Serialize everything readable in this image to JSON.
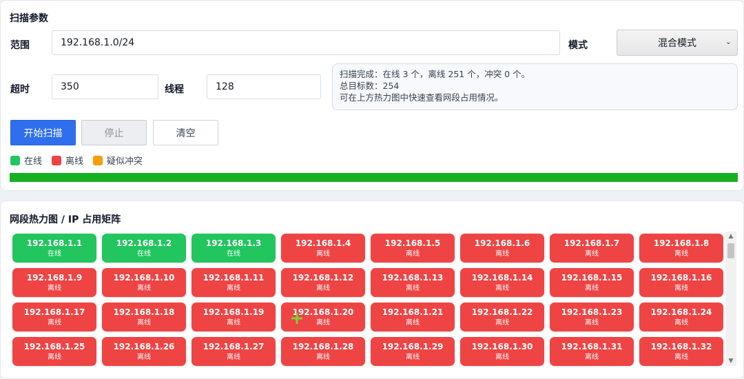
{
  "params": {
    "title": "扫描参数",
    "range_label": "范围",
    "range_value": "192.168.1.0/24",
    "mode_label": "模式",
    "mode_value": "混合模式",
    "timeout_label": "超时",
    "timeout_value": "350",
    "threads_label": "线程",
    "threads_value": "128",
    "info_lines": [
      "扫描完成：在线 3 个，离线 251 个，冲突 0 个。",
      "总目标数：254",
      "可在上方热力图中快速查看网段占用情况。"
    ],
    "buttons": {
      "start": "开始扫描",
      "stop": "停止",
      "clear": "清空"
    },
    "legend": [
      {
        "label": "在线",
        "color": "#22c55e"
      },
      {
        "label": "离线",
        "color": "#ef4444"
      },
      {
        "label": "疑似冲突",
        "color": "#f59e0b"
      }
    ],
    "progress_percent": 100
  },
  "heatmap": {
    "title": "网段热力图 / IP 占用矩阵",
    "colors": {
      "online": "#22c55e",
      "offline": "#ef4444",
      "conflict": "#f59e0b"
    },
    "cells": [
      {
        "ip": "192.168.1.1",
        "status": "在线"
      },
      {
        "ip": "192.168.1.2",
        "status": "在线"
      },
      {
        "ip": "192.168.1.3",
        "status": "在线"
      },
      {
        "ip": "192.168.1.4",
        "status": "离线"
      },
      {
        "ip": "192.168.1.5",
        "status": "离线"
      },
      {
        "ip": "192.168.1.6",
        "status": "离线"
      },
      {
        "ip": "192.168.1.7",
        "status": "离线"
      },
      {
        "ip": "192.168.1.8",
        "status": "离线"
      },
      {
        "ip": "192.168.1.9",
        "status": "离线"
      },
      {
        "ip": "192.168.1.10",
        "status": "离线"
      },
      {
        "ip": "192.168.1.11",
        "status": "离线"
      },
      {
        "ip": "192.168.1.12",
        "status": "离线"
      },
      {
        "ip": "192.168.1.13",
        "status": "离线"
      },
      {
        "ip": "192.168.1.14",
        "status": "离线"
      },
      {
        "ip": "192.168.1.15",
        "status": "离线"
      },
      {
        "ip": "192.168.1.16",
        "status": "离线"
      },
      {
        "ip": "192.168.1.17",
        "status": "离线"
      },
      {
        "ip": "192.168.1.18",
        "status": "离线"
      },
      {
        "ip": "192.168.1.19",
        "status": "离线"
      },
      {
        "ip": "192.168.1.20",
        "status": "离线"
      },
      {
        "ip": "192.168.1.21",
        "status": "离线"
      },
      {
        "ip": "192.168.1.22",
        "status": "离线"
      },
      {
        "ip": "192.168.1.23",
        "status": "离线"
      },
      {
        "ip": "192.168.1.24",
        "status": "离线"
      },
      {
        "ip": "192.168.1.25",
        "status": "离线"
      },
      {
        "ip": "192.168.1.26",
        "status": "离线"
      },
      {
        "ip": "192.168.1.27",
        "status": "离线"
      },
      {
        "ip": "192.168.1.28",
        "status": "离线"
      },
      {
        "ip": "192.168.1.29",
        "status": "离线"
      },
      {
        "ip": "192.168.1.30",
        "status": "离线"
      },
      {
        "ip": "192.168.1.31",
        "status": "离线"
      },
      {
        "ip": "192.168.1.32",
        "status": "离线"
      }
    ]
  }
}
